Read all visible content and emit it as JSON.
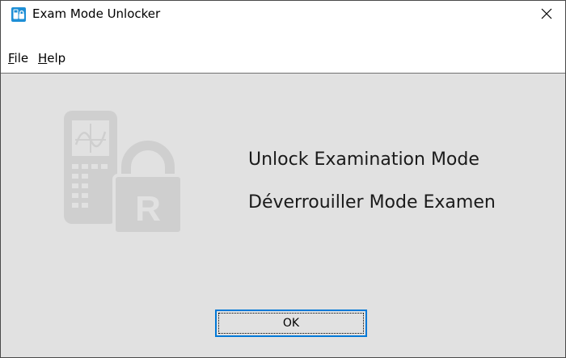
{
  "window": {
    "title": "Exam Mode Unlocker"
  },
  "menu": {
    "file_mnemonic": "F",
    "file_rest": "ile",
    "help_mnemonic": "H",
    "help_rest": "elp"
  },
  "content": {
    "line_en": "Unlock Examination Mode",
    "line_fr": "Déverrouiller Mode Examen",
    "badge_letter": "R"
  },
  "buttons": {
    "ok_label": "OK"
  },
  "icons": {
    "app": "calculator-lock-icon",
    "close": "close-icon",
    "graphic": "calculator-padlock-icon"
  },
  "colors": {
    "accent": "#0078d7",
    "client_bg": "#e1e1e1",
    "graphic": "#cfcfcf"
  }
}
